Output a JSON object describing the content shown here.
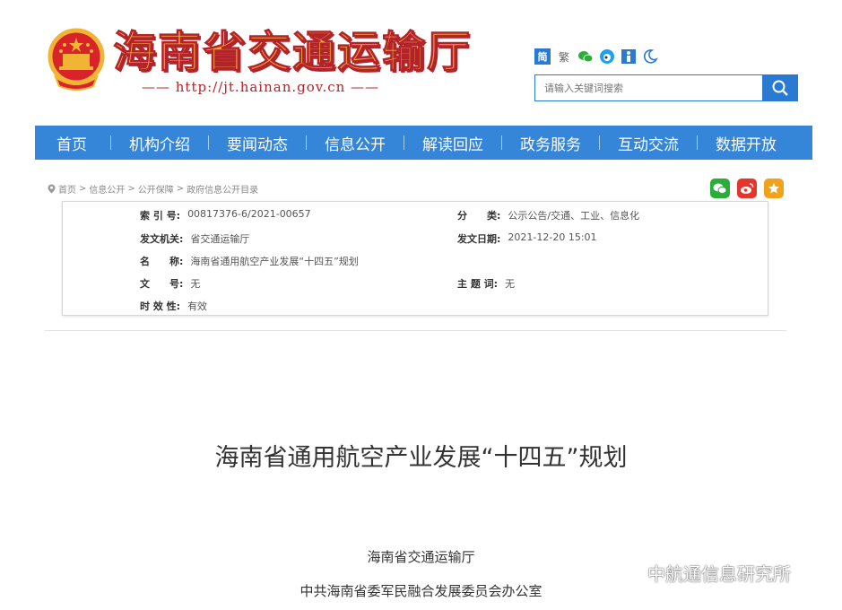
{
  "header": {
    "site_title": "海南省交通运输厅",
    "site_url": "—— http://jt.hainan.gov.cn ——",
    "tools": {
      "simplified": "简",
      "traditional": "繁"
    },
    "search": {
      "placeholder": "请输入关键词搜索"
    }
  },
  "nav": {
    "items": [
      {
        "label": "首页"
      },
      {
        "label": "机构介绍"
      },
      {
        "label": "要闻动态"
      },
      {
        "label": "信息公开"
      },
      {
        "label": "解读回应"
      },
      {
        "label": "政务服务"
      },
      {
        "label": "互动交流"
      },
      {
        "label": "数据开放"
      }
    ]
  },
  "breadcrumb": {
    "items": [
      "首页",
      "信息公开",
      "公开保障",
      "政府信息公开目录"
    ],
    "separator": ">"
  },
  "info": {
    "index_label": "索 引 号:",
    "index_value": "00817376-6/2021-00657",
    "category_label": "分　　类:",
    "category_value": "公示公告/交通、工业、信息化",
    "issuer_label": "发文机关:",
    "issuer_value": "省交通运输厅",
    "date_label": "发文日期:",
    "date_value": "2021-12-20 15:01",
    "name_label": "名　　称:",
    "name_value": "海南省通用航空产业发展“十四五”规划",
    "docno_label": "文　　号:",
    "docno_value": "无",
    "keywords_label": "主 题 词:",
    "keywords_value": "无",
    "validity_label": "时 效 性:",
    "validity_value": "有效"
  },
  "document": {
    "title": "海南省通用航空产业发展“十四五”规划",
    "issuer_1": "海南省交通运输厅",
    "issuer_2": "中共海南省委军民融合发展委员会办公室"
  },
  "watermark": {
    "text": "中航通信息研究所"
  },
  "colors": {
    "nav_bg": "#3585d8",
    "accent": "#2a7ad2",
    "title_red": "#b3232a",
    "title_gold": "#f3a63c"
  }
}
